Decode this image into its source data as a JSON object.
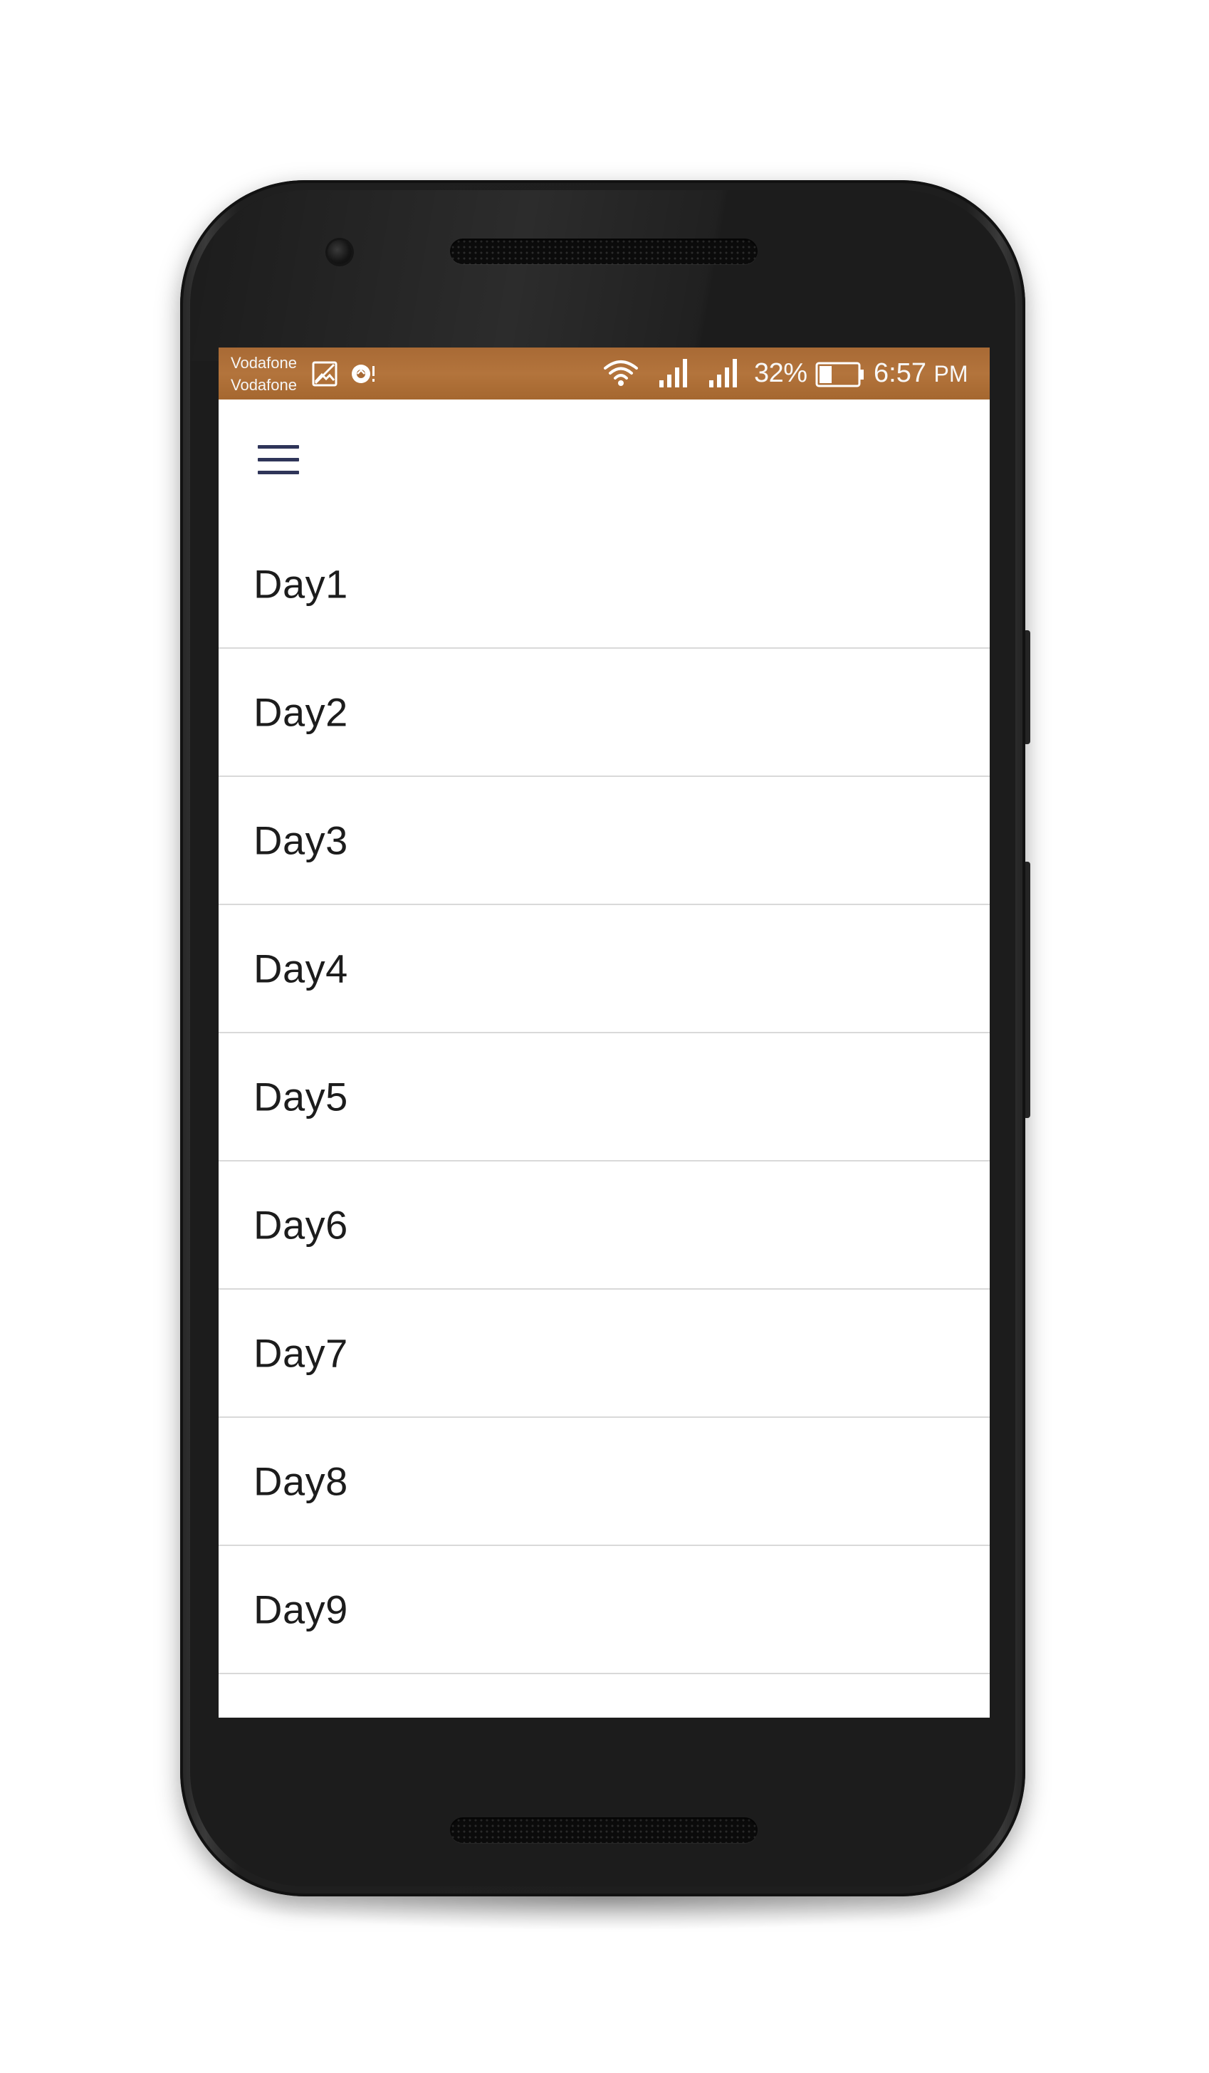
{
  "status_bar": {
    "carrier_line1": "Vodafone",
    "carrier_line2": "Vodafone",
    "battery_percent": "32%",
    "time": "6:57",
    "ampm": "PM",
    "icons": [
      "gallery-icon",
      "sync-icon",
      "wifi-icon",
      "signal-icon",
      "signal-icon",
      "battery-icon"
    ],
    "background_color": "#b3743c"
  },
  "app_bar": {
    "menu_icon": "hamburger-menu-icon",
    "icon_color": "#2f3559"
  },
  "days": [
    {
      "label": "Day1"
    },
    {
      "label": "Day2"
    },
    {
      "label": "Day3"
    },
    {
      "label": "Day4"
    },
    {
      "label": "Day5"
    },
    {
      "label": "Day6"
    },
    {
      "label": "Day7"
    },
    {
      "label": "Day8"
    },
    {
      "label": "Day9"
    }
  ]
}
